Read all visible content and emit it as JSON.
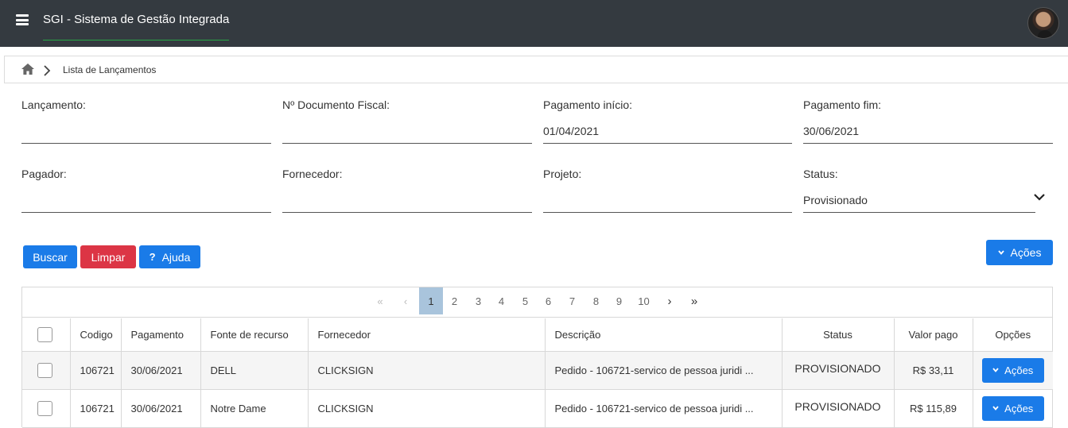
{
  "header": {
    "title": "SGI - Sistema de Gestão Integrada"
  },
  "breadcrumb": {
    "current": "Lista de Lançamentos"
  },
  "filters": {
    "lancamento": {
      "label": "Lançamento:",
      "value": ""
    },
    "documento": {
      "label": "Nº Documento Fiscal:",
      "value": ""
    },
    "pagamento_inicio": {
      "label": "Pagamento início:",
      "value": "01/04/2021"
    },
    "pagamento_fim": {
      "label": "Pagamento fim:",
      "value": "30/06/2021"
    },
    "pagador": {
      "label": "Pagador:",
      "value": ""
    },
    "fornecedor": {
      "label": "Fornecedor:",
      "value": ""
    },
    "projeto": {
      "label": "Projeto:",
      "value": ""
    },
    "status": {
      "label": "Status:",
      "value": "Provisionado"
    }
  },
  "buttons": {
    "buscar": "Buscar",
    "limpar": "Limpar",
    "ajuda": "Ajuda",
    "ajuda_icon": "?",
    "acoes": "Ações"
  },
  "pagination": {
    "first": "«",
    "prev": "‹",
    "pages": [
      "1",
      "2",
      "3",
      "4",
      "5",
      "6",
      "7",
      "8",
      "9",
      "10"
    ],
    "next": "›",
    "last": "»",
    "current": "1"
  },
  "table": {
    "columns": [
      "Codigo",
      "Pagamento",
      "Fonte de recurso",
      "Fornecedor",
      "Descrição",
      "Status",
      "Valor pago",
      "Opções"
    ],
    "rows": [
      {
        "codigo": "106721",
        "pagamento": "30/06/2021",
        "fonte": "DELL",
        "fornecedor": "CLICKSIGN",
        "descricao": "Pedido - 106721-servico de pessoa juridi ...",
        "status": "PROVISIONADO",
        "valor": "R$ 33,11",
        "acao": "Ações"
      },
      {
        "codigo": "106721",
        "pagamento": "30/06/2021",
        "fonte": "Notre Dame",
        "fornecedor": "CLICKSIGN",
        "descricao": "Pedido - 106721-servico de pessoa juridi ...",
        "status": "PROVISIONADO",
        "valor": "R$ 115,89",
        "acao": "Ações"
      }
    ]
  },
  "colors": {
    "topbar": "#343a40",
    "primary": "#1a7be8",
    "danger": "#dc3545",
    "accent_line": "#28a745"
  },
  "icons": {
    "menu": "hamburger-icon",
    "home": "home-icon",
    "dropdown": "chevron-down-icon",
    "user": "avatar"
  }
}
